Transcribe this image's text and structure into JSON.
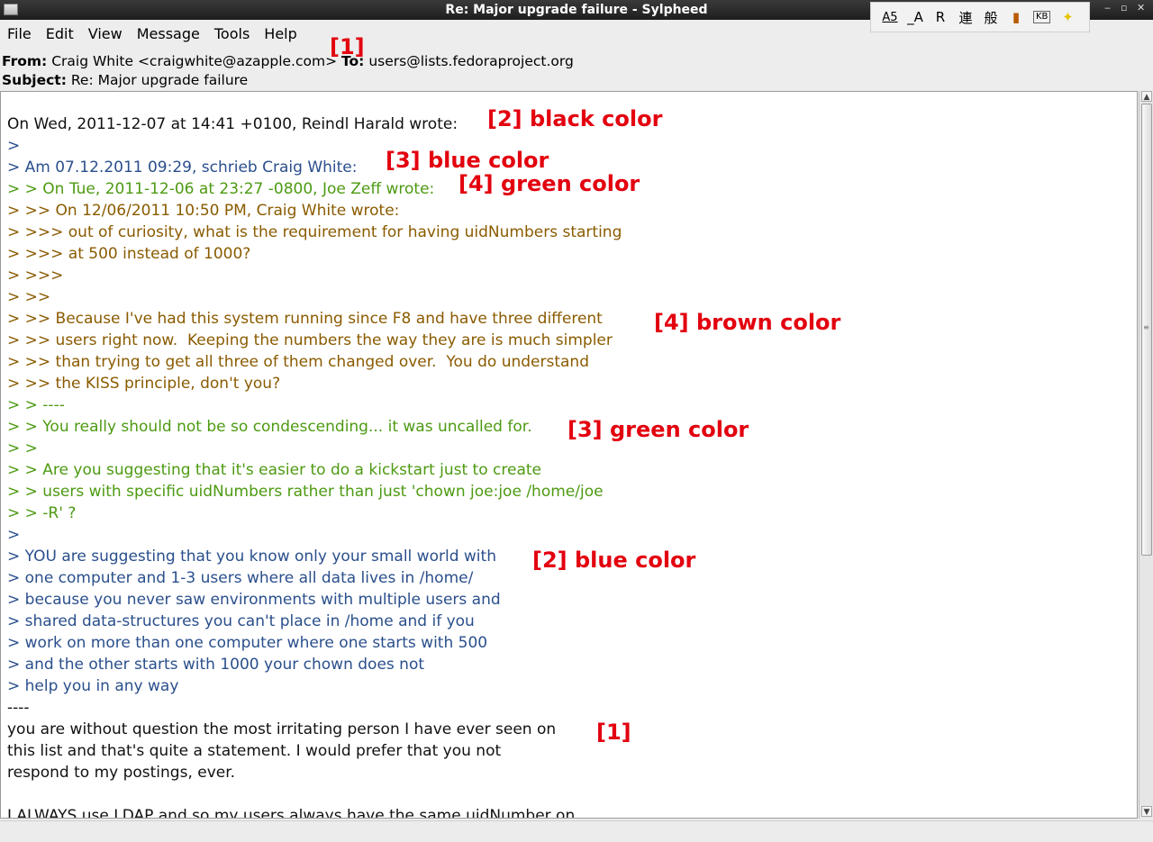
{
  "window": {
    "title": "Re: Major upgrade failure - Sylpheed",
    "controls": [
      "‒",
      "▫",
      "✕"
    ]
  },
  "im_toolbar": {
    "items": [
      "A5",
      "_A",
      "R",
      "連",
      "般",
      "book",
      "kbd",
      "★"
    ]
  },
  "menu": [
    "File",
    "Edit",
    "View",
    "Message",
    "Tools",
    "Help"
  ],
  "headers": {
    "from_label": "From:",
    "from_value": "Craig White <craigwhite@azapple.com>",
    "to_label": "To:",
    "to_value": "users@lists.fedoraproject.org",
    "subject_label": "Subject:",
    "subject_value": "Re: Major upgrade failure"
  },
  "body_lines": [
    {
      "text": "On Wed, 2011-12-07 at 14:41 +0100, Reindl Harald wrote:",
      "color": "black"
    },
    {
      "text": ">",
      "color": "blue"
    },
    {
      "text": "> Am 07.12.2011 09:29, schrieb Craig White:",
      "color": "blue"
    },
    {
      "text": "> > On Tue, 2011-12-06 at 23:27 -0800, Joe Zeff wrote:",
      "color": "green"
    },
    {
      "text": "> >> On 12/06/2011 10:50 PM, Craig White wrote:",
      "color": "brown"
    },
    {
      "text": "> >>> out of curiosity, what is the requirement for having uidNumbers starting",
      "color": "brown"
    },
    {
      "text": "> >>> at 500 instead of 1000?",
      "color": "brown"
    },
    {
      "text": "> >>>",
      "color": "brown"
    },
    {
      "text": "> >>",
      "color": "brown"
    },
    {
      "text": "> >> Because I've had this system running since F8 and have three different",
      "color": "brown"
    },
    {
      "text": "> >> users right now.  Keeping the numbers the way they are is much simpler",
      "color": "brown"
    },
    {
      "text": "> >> than trying to get all three of them changed over.  You do understand",
      "color": "brown"
    },
    {
      "text": "> >> the KISS principle, don't you?",
      "color": "brown"
    },
    {
      "text": "> > ----",
      "color": "green"
    },
    {
      "text": "> > You really should not be so condescending... it was uncalled for.",
      "color": "green"
    },
    {
      "text": "> >",
      "color": "green"
    },
    {
      "text": "> > Are you suggesting that it's easier to do a kickstart just to create",
      "color": "green"
    },
    {
      "text": "> > users with specific uidNumbers rather than just 'chown joe:joe /home/joe",
      "color": "green"
    },
    {
      "text": "> > -R' ?",
      "color": "green"
    },
    {
      "text": ">",
      "color": "blue"
    },
    {
      "text": "> YOU are suggesting that you know only your small world with",
      "color": "blue"
    },
    {
      "text": "> one computer and 1-3 users where all data lives in /home/",
      "color": "blue"
    },
    {
      "text": "> because you never saw environments with multiple users and",
      "color": "blue"
    },
    {
      "text": "> shared data-structures you can't place in /home and if you",
      "color": "blue"
    },
    {
      "text": "> work on more than one computer where one starts with 500",
      "color": "blue"
    },
    {
      "text": "> and the other starts with 1000 your chown does not",
      "color": "blue"
    },
    {
      "text": "> help you in any way",
      "color": "blue"
    },
    {
      "text": "----",
      "color": "black"
    },
    {
      "text": "you are without question the most irritating person I have ever seen on",
      "color": "black"
    },
    {
      "text": "this list and that's quite a statement. I would prefer that you not",
      "color": "black"
    },
    {
      "text": "respond to my postings, ever.",
      "color": "black"
    },
    {
      "text": "",
      "color": "black"
    },
    {
      "text": "I ALWAYS use LDAP and so my users always have the same uidNumber on",
      "color": "black"
    }
  ],
  "annotations": [
    {
      "text": "[1]"
    },
    {
      "text": "[2] black color"
    },
    {
      "text": "[3] blue color"
    },
    {
      "text": "[4] green color"
    },
    {
      "text": "[4] brown color"
    },
    {
      "text": "[3] green color"
    },
    {
      "text": "[2] blue color"
    },
    {
      "text": "[1]"
    }
  ],
  "colors": {
    "black": "#111111",
    "blue": "#2a4f8c",
    "green": "#4d9a12",
    "brown": "#8a5b00",
    "annotation": "#e3000f"
  }
}
